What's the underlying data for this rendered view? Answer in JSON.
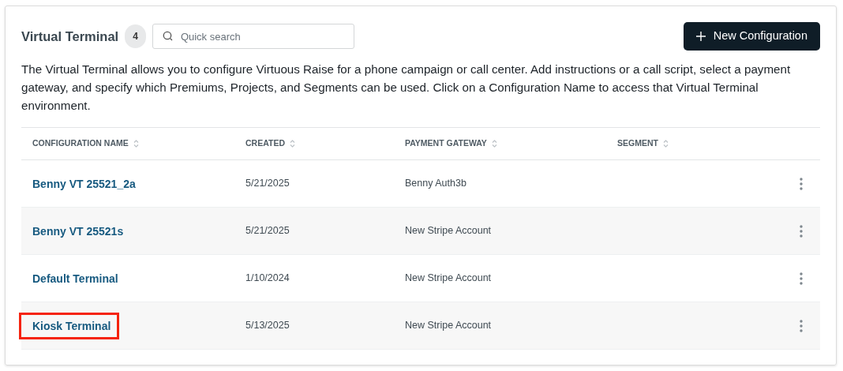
{
  "header": {
    "title": "Virtual Terminal",
    "count": "4",
    "search": {
      "placeholder": "Quick search"
    },
    "new_button": "New Configuration"
  },
  "description": "The Virtual Terminal allows you to configure Virtuous Raise for a phone campaign or call center. Add instructions or a call script, select a payment gateway, and specify which Premiums, Projects, and Segments can be used. Click on a Configuration Name to access that Virtual Terminal environment.",
  "table": {
    "columns": [
      "CONFIGURATION NAME",
      "CREATED",
      "PAYMENT GATEWAY",
      "SEGMENT"
    ],
    "rows": [
      {
        "name": "Benny VT 25521_2a",
        "created": "5/21/2025",
        "gateway": "Benny Auth3b",
        "highlighted": false
      },
      {
        "name": "Benny VT 25521s",
        "created": "5/21/2025",
        "gateway": "New Stripe Account",
        "highlighted": false
      },
      {
        "name": "Default Terminal",
        "created": "1/10/2024",
        "gateway": "New Stripe Account",
        "highlighted": false
      },
      {
        "name": "Kiosk Terminal",
        "created": "5/13/2025",
        "gateway": "New Stripe Account",
        "highlighted": true
      }
    ]
  }
}
